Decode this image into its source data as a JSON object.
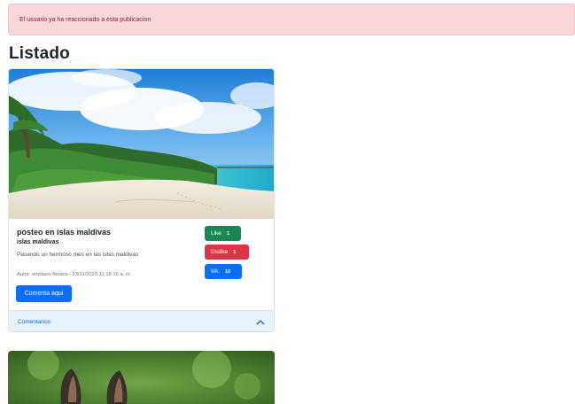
{
  "alert": {
    "text": "El usuario ya ha reaccionado a esta publicacion",
    "color": "#f8d7da"
  },
  "page": {
    "title": "Listado"
  },
  "post": {
    "title": "posteo en islas maldivas",
    "subtitle": "islas maldivas",
    "text": "Pasando un hermoso mes en las islas maldivas",
    "meta": "Autor: emiliano ferrera - 23/11/2023 11:18:16 a. m.",
    "image_icon": "beach-photo-icon",
    "comment_button": "Comenta aqui",
    "reactions": {
      "like_label": "Like",
      "like_count": "1",
      "dislike_label": "Dislike",
      "dislike_count": "1",
      "va_label": "VA:",
      "va_count": "10"
    },
    "comments_label": "Comentarios",
    "comments_icon": "chevron-up-icon"
  },
  "next_post": {
    "image_icon": "animal-photo-icon"
  },
  "colors": {
    "primary": "#0d6efd",
    "success": "#198754",
    "danger": "#dc3545",
    "accordion_bg": "#e7f1ff"
  }
}
